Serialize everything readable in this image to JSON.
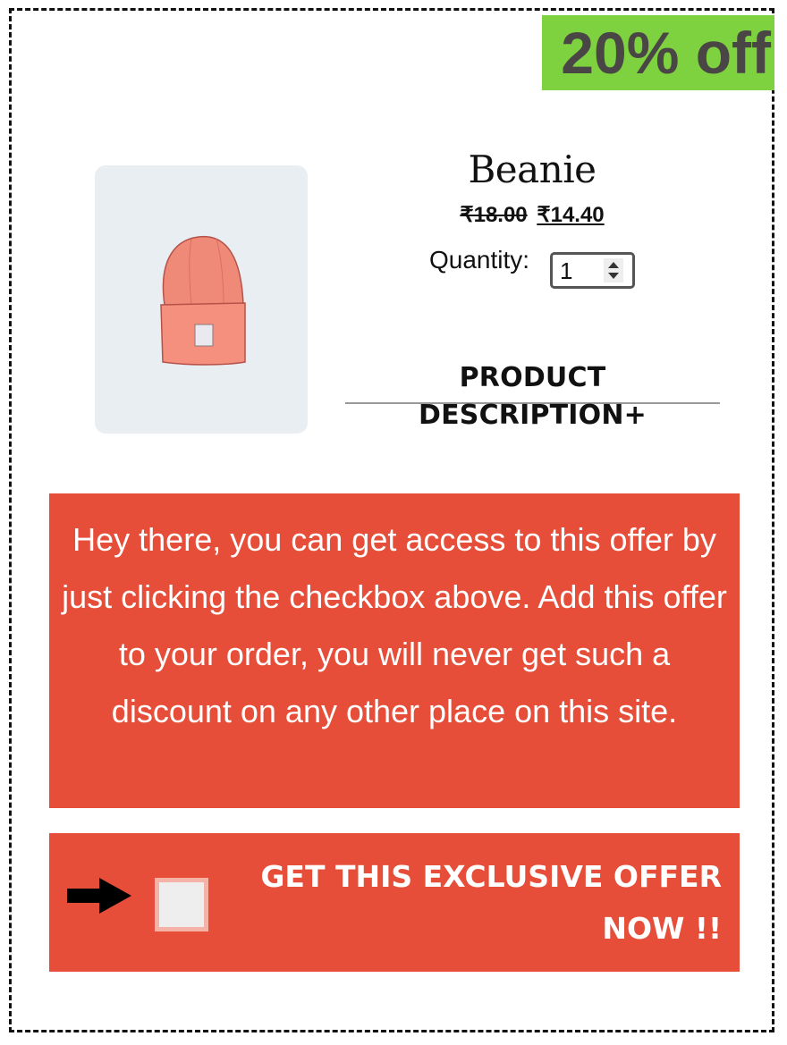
{
  "badge": {
    "text": "20% off",
    "color": "#7ed23f"
  },
  "product": {
    "title": "Beanie",
    "price_old": "₹18.00",
    "price_new": "₹14.40",
    "image_icon": "beanie-hat-icon"
  },
  "quantity": {
    "label": "Quantity:",
    "value": "1"
  },
  "description": {
    "toggle_label": "PRODUCT DESCRIPTION+"
  },
  "message": {
    "text": "Hey there, you can get access to this offer by just clicking the checkbox above. Add this offer to your order, you will never get such a discount on any other place on this site.",
    "background": "#e64e39"
  },
  "offer": {
    "label": "GET THIS EXCLUSIVE OFFER NOW !!",
    "checked": false,
    "arrow_icon": "arrow-right-icon",
    "background": "#e64e39"
  }
}
